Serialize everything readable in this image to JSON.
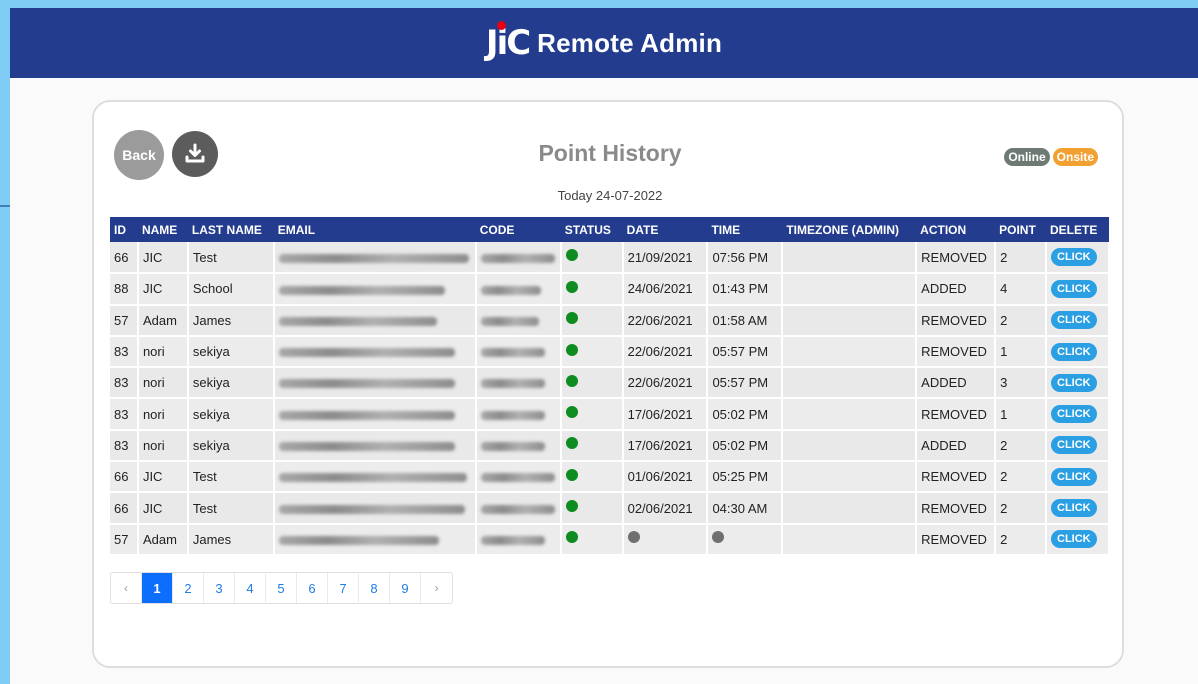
{
  "header": {
    "logo_text": "JiC",
    "app_title": "Remote Admin"
  },
  "card": {
    "back_label": "Back",
    "title": "Point History",
    "today": "Today 24-07-2022",
    "legend": {
      "online": "Online",
      "onsite": "Onsite"
    }
  },
  "table": {
    "columns": [
      "ID",
      "NAME",
      "LAST NAME",
      "EMAIL",
      "CODE",
      "STATUS",
      "DATE",
      "TIME",
      "TIMEZONE (ADMIN)",
      "ACTION",
      "POINT",
      "DELETE"
    ],
    "rows": [
      {
        "id": "66",
        "name": "JIC",
        "last": "Test",
        "status": "green",
        "date": "21/09/2021",
        "time": "07:56 PM",
        "tz": "",
        "action": "REMOVED",
        "point": "2",
        "del": "CLICK"
      },
      {
        "id": "88",
        "name": "JIC",
        "last": "School",
        "status": "green",
        "date": "24/06/2021",
        "time": "01:43 PM",
        "tz": "",
        "action": "ADDED",
        "point": "4",
        "del": "CLICK"
      },
      {
        "id": "57",
        "name": "Adam",
        "last": "James",
        "status": "green",
        "date": "22/06/2021",
        "time": "01:58 AM",
        "tz": "",
        "action": "REMOVED",
        "point": "2",
        "del": "CLICK"
      },
      {
        "id": "83",
        "name": "nori",
        "last": "sekiya",
        "status": "green",
        "date": "22/06/2021",
        "time": "05:57 PM",
        "tz": "",
        "action": "REMOVED",
        "point": "1",
        "del": "CLICK"
      },
      {
        "id": "83",
        "name": "nori",
        "last": "sekiya",
        "status": "green",
        "date": "22/06/2021",
        "time": "05:57 PM",
        "tz": "",
        "action": "ADDED",
        "point": "3",
        "del": "CLICK"
      },
      {
        "id": "83",
        "name": "nori",
        "last": "sekiya",
        "status": "green",
        "date": "17/06/2021",
        "time": "05:02 PM",
        "tz": "",
        "action": "REMOVED",
        "point": "1",
        "del": "CLICK"
      },
      {
        "id": "83",
        "name": "nori",
        "last": "sekiya",
        "status": "green",
        "date": "17/06/2021",
        "time": "05:02 PM",
        "tz": "",
        "action": "ADDED",
        "point": "2",
        "del": "CLICK"
      },
      {
        "id": "66",
        "name": "JIC",
        "last": "Test",
        "status": "green",
        "date": "01/06/2021",
        "time": "05:25 PM",
        "tz": "",
        "action": "REMOVED",
        "point": "2",
        "del": "CLICK"
      },
      {
        "id": "66",
        "name": "JIC",
        "last": "Test",
        "status": "green",
        "date": "02/06/2021",
        "time": "04:30 AM",
        "tz": "",
        "action": "REMOVED",
        "point": "2",
        "del": "CLICK"
      },
      {
        "id": "57",
        "name": "Adam",
        "last": "James",
        "status": "green",
        "date": "gray-dot",
        "time": "gray-dot",
        "tz": "",
        "action": "REMOVED",
        "point": "2",
        "del": "CLICK"
      }
    ]
  },
  "pagination": {
    "prev": "‹",
    "next": "›",
    "pages": [
      "1",
      "2",
      "3",
      "4",
      "5",
      "6",
      "7",
      "8",
      "9"
    ],
    "active": "1"
  },
  "colors": {
    "header_bg": "#233c8e",
    "status_online": "#0e8c1f",
    "status_unknown": "#6f6f6f",
    "click_btn": "#2a9fe3",
    "onsite": "#f3a033"
  },
  "icons": {
    "download": "download-icon"
  }
}
